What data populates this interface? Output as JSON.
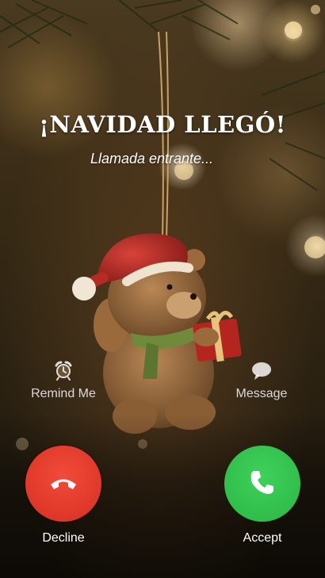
{
  "call": {
    "caller_name": "¡NAVIDAD LLEGÓ!",
    "status": "Llamada entrante..."
  },
  "quick_actions": {
    "remind": {
      "label": "Remind Me",
      "icon": "alarm-clock-icon"
    },
    "message": {
      "label": "Message",
      "icon": "chat-bubble-icon"
    }
  },
  "buttons": {
    "decline": {
      "label": "Decline",
      "icon": "phone-hangup-icon",
      "color": "#e8392b"
    },
    "accept": {
      "label": "Accept",
      "icon": "phone-icon",
      "color": "#34c84e"
    }
  }
}
